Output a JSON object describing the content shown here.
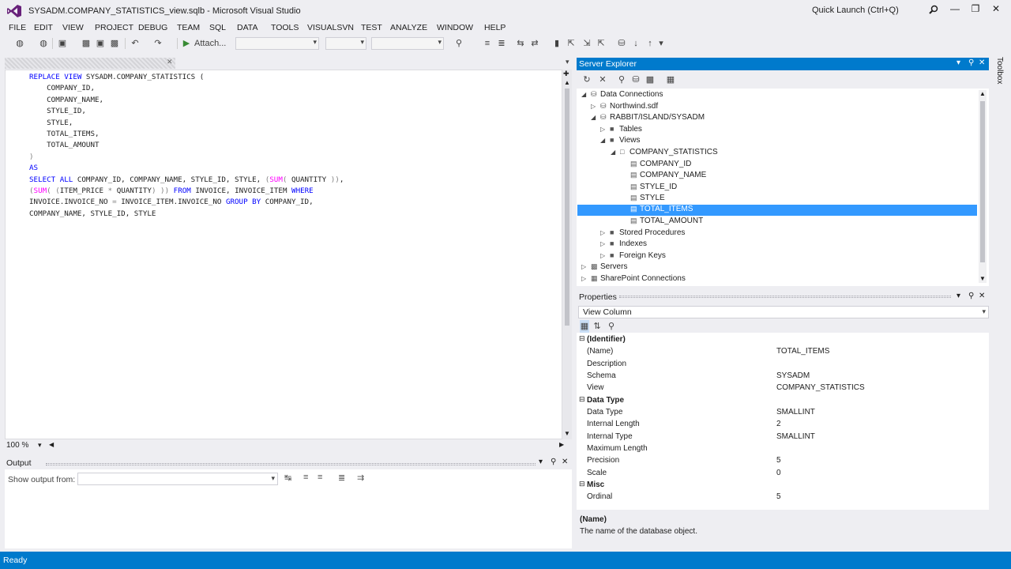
{
  "window": {
    "title": "SYSADM.COMPANY_STATISTICS_view.sqlb - Microsoft Visual Studio",
    "quick_launch_placeholder": "Quick Launch (Ctrl+Q)"
  },
  "menu": [
    "FILE",
    "EDIT",
    "VIEW",
    "PROJECT",
    "DEBUG",
    "TEAM",
    "SQL",
    "DATA",
    "TOOLS",
    "VISUALSVN",
    "TEST",
    "ANALYZE",
    "WINDOW",
    "HELP"
  ],
  "toolbar": {
    "attach_label": "Attach..."
  },
  "editor": {
    "zoom": "100 %",
    "lines": [
      "REPLACE VIEW SYSADM.COMPANY_STATISTICS (",
      "    COMPANY_ID,",
      "    COMPANY_NAME,",
      "    STYLE_ID,",
      "    STYLE,",
      "    TOTAL_ITEMS,",
      "    TOTAL_AMOUNT",
      ")",
      "AS",
      "SELECT ALL COMPANY_ID, COMPANY_NAME, STYLE_ID, STYLE, (SUM( QUANTITY )),",
      "(SUM( (ITEM_PRICE * QUANTITY) )) FROM INVOICE, INVOICE_ITEM WHERE",
      "INVOICE.INVOICE_NO = INVOICE_ITEM.INVOICE_NO GROUP BY COMPANY_ID,",
      "COMPANY_NAME, STYLE_ID, STYLE"
    ]
  },
  "output": {
    "title": "Output",
    "show_output_from": "Show output from:"
  },
  "server_explorer": {
    "title": "Server Explorer",
    "nodes": [
      {
        "label": "Data Connections"
      },
      {
        "label": "Northwind.sdf"
      },
      {
        "label": "RABBIT/ISLAND/SYSADM"
      },
      {
        "label": "Tables"
      },
      {
        "label": "Views"
      },
      {
        "label": "COMPANY_STATISTICS"
      },
      {
        "label": "COMPANY_ID"
      },
      {
        "label": "COMPANY_NAME"
      },
      {
        "label": "STYLE_ID"
      },
      {
        "label": "STYLE"
      },
      {
        "label": "TOTAL_ITEMS"
      },
      {
        "label": "TOTAL_AMOUNT"
      },
      {
        "label": "Stored Procedures"
      },
      {
        "label": "Indexes"
      },
      {
        "label": "Foreign Keys"
      },
      {
        "label": "Servers"
      },
      {
        "label": "SharePoint Connections"
      }
    ],
    "selected": "TOTAL_ITEMS"
  },
  "properties": {
    "title": "Properties",
    "object": "View Column",
    "rows": [
      {
        "name": "(Identifier)",
        "value": "",
        "category": true
      },
      {
        "name": "(Name)",
        "value": "TOTAL_ITEMS"
      },
      {
        "name": "Description",
        "value": ""
      },
      {
        "name": "Schema",
        "value": "SYSADM"
      },
      {
        "name": "View",
        "value": "COMPANY_STATISTICS"
      },
      {
        "name": "Data Type",
        "value": "",
        "category": true
      },
      {
        "name": "Data Type",
        "value": "SMALLINT"
      },
      {
        "name": "Internal Length",
        "value": "2"
      },
      {
        "name": "Internal Type",
        "value": "SMALLINT"
      },
      {
        "name": "Maximum Length",
        "value": ""
      },
      {
        "name": "Precision",
        "value": "5"
      },
      {
        "name": "Scale",
        "value": "0"
      },
      {
        "name": "Misc",
        "value": "",
        "category": true
      },
      {
        "name": "Ordinal",
        "value": "5"
      }
    ],
    "description_title": "(Name)",
    "description_text": "The name of the database object."
  },
  "toolbox": "Toolbox",
  "status": "Ready",
  "colors": {
    "accent": "#007acc",
    "selection": "#3399ff"
  }
}
